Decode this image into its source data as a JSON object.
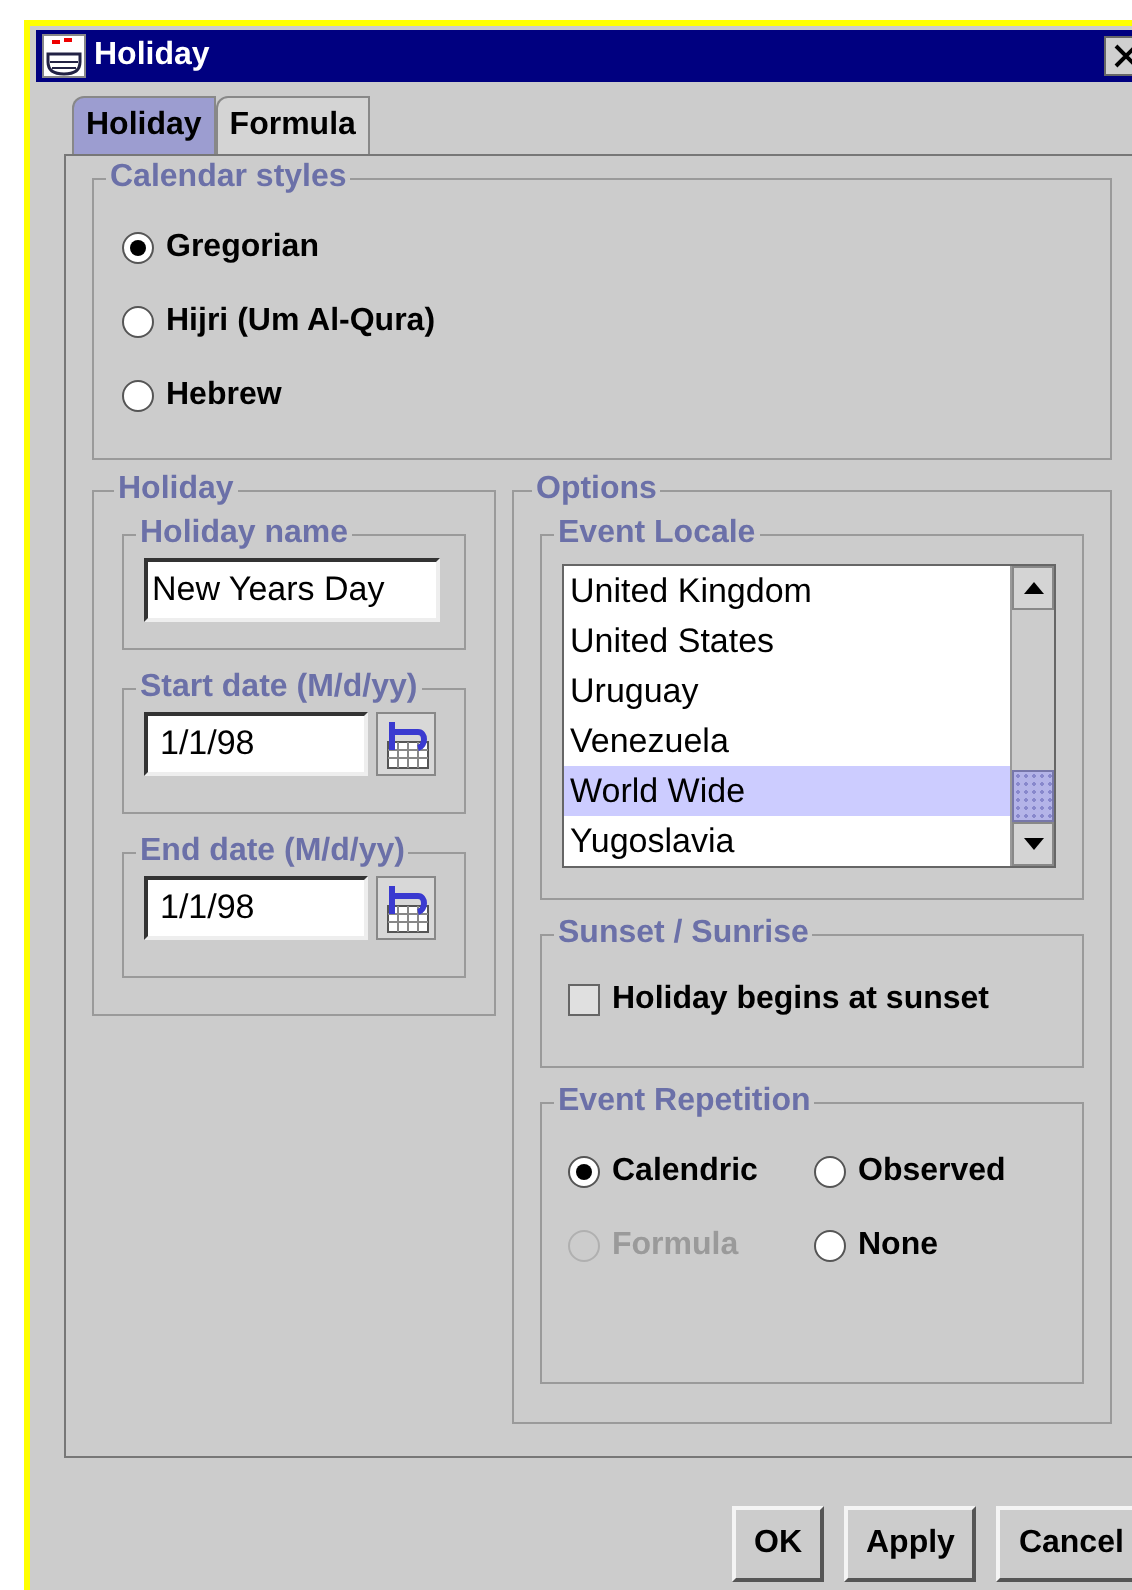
{
  "window": {
    "title": "Holiday"
  },
  "tabs": [
    {
      "label": "Holiday",
      "selected": true
    },
    {
      "label": "Formula",
      "selected": false
    }
  ],
  "calendar_styles": {
    "title": "Calendar styles",
    "options": [
      {
        "label": "Gregorian",
        "selected": true
      },
      {
        "label": "Hijri (Um Al-Qura)",
        "selected": false
      },
      {
        "label": "Hebrew",
        "selected": false
      }
    ]
  },
  "holiday": {
    "title": "Holiday",
    "name": {
      "title": "Holiday name",
      "value": "New Years Day"
    },
    "start_date": {
      "title": "Start date (M/d/yy)",
      "value": "1/1/98"
    },
    "end_date": {
      "title": "End date (M/d/yy)",
      "value": "1/1/98"
    }
  },
  "options": {
    "title": "Options",
    "event_locale": {
      "title": "Event Locale",
      "items": [
        {
          "label": "United Kingdom",
          "selected": false
        },
        {
          "label": "United States",
          "selected": false
        },
        {
          "label": "Uruguay",
          "selected": false
        },
        {
          "label": "Venezuela",
          "selected": false
        },
        {
          "label": "World Wide",
          "selected": true
        },
        {
          "label": "Yugoslavia",
          "selected": false
        }
      ]
    },
    "sunset": {
      "title": "Sunset / Sunrise",
      "checkbox": {
        "label": "Holiday begins at sunset",
        "checked": false
      }
    },
    "repetition": {
      "title": "Event Repetition",
      "options": [
        {
          "label": "Calendric",
          "selected": true,
          "disabled": false
        },
        {
          "label": "Observed",
          "selected": false,
          "disabled": false
        },
        {
          "label": "Formula",
          "selected": false,
          "disabled": true
        },
        {
          "label": "None",
          "selected": false,
          "disabled": false
        }
      ]
    }
  },
  "buttons": [
    "OK",
    "Apply",
    "Cancel"
  ]
}
